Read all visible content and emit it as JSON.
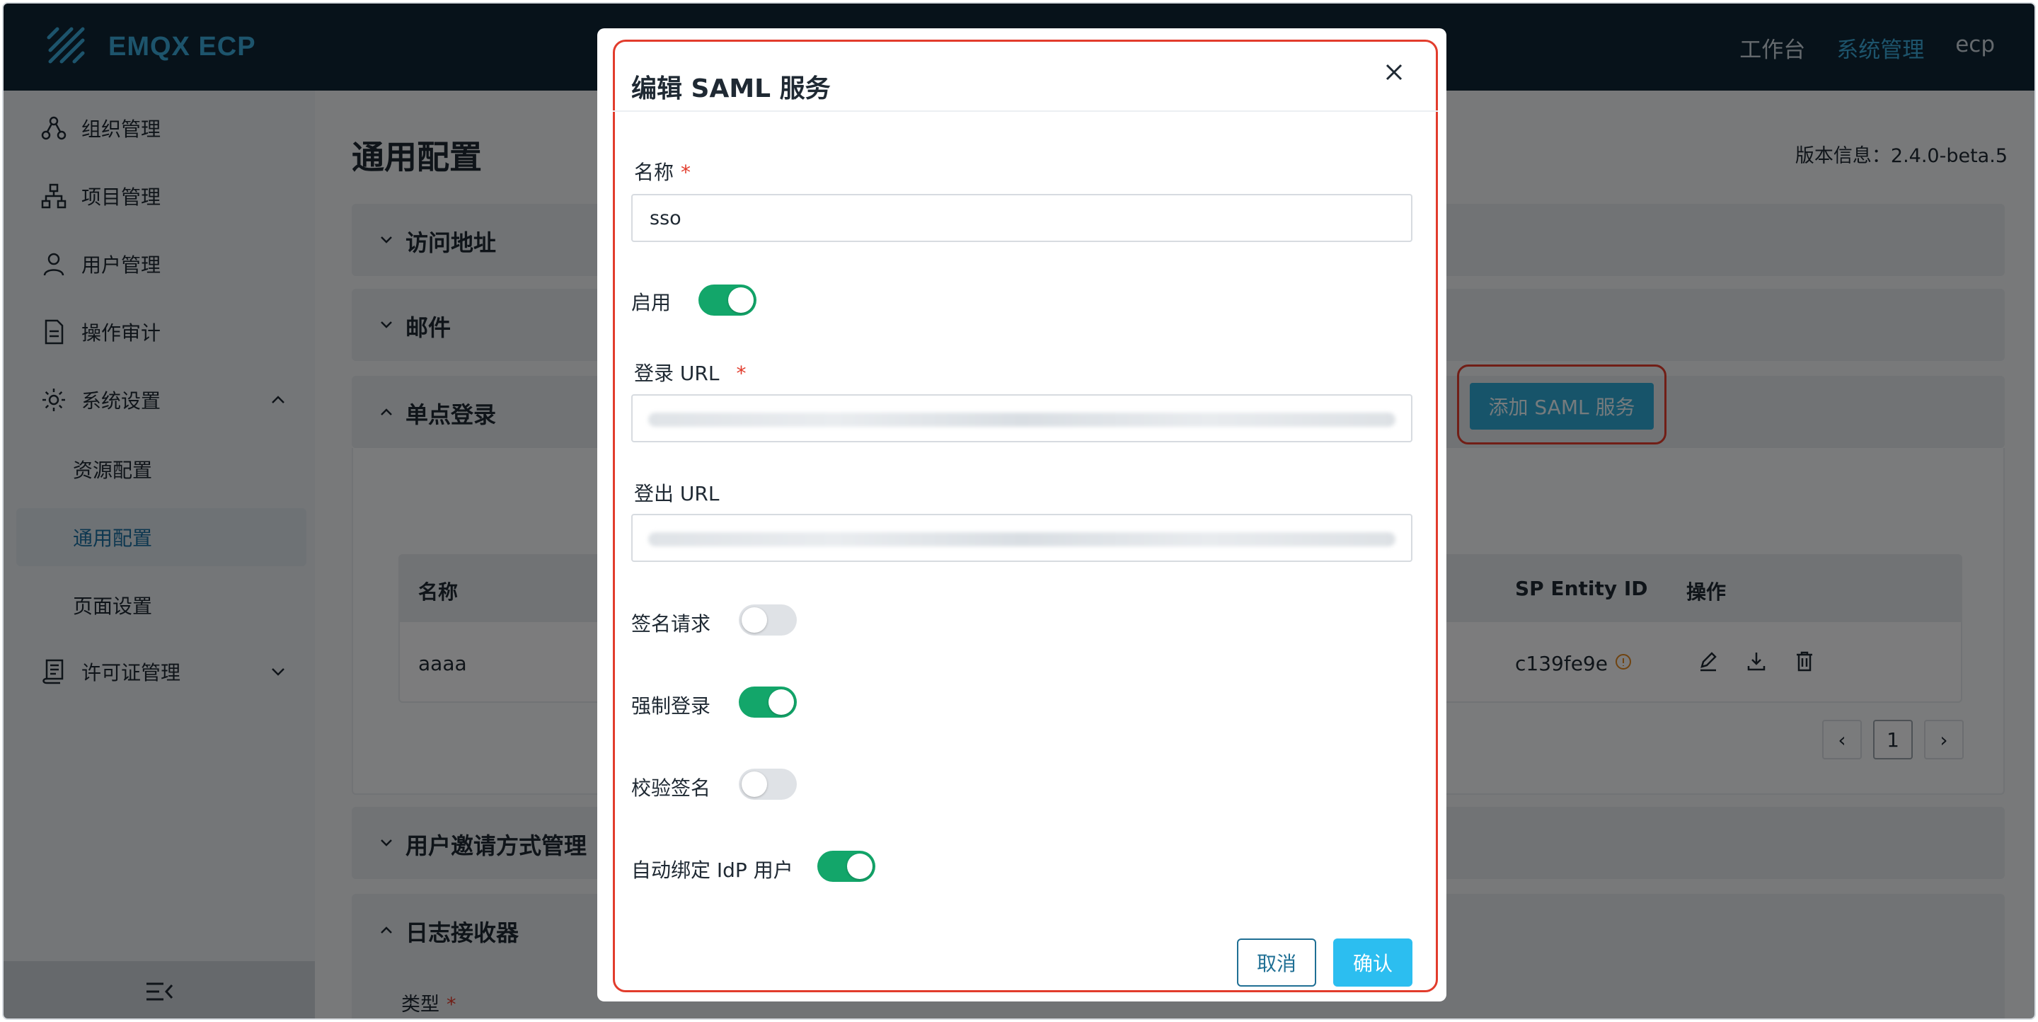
{
  "header": {
    "brand": "EMQX ECP",
    "nav": [
      "工作台",
      "系统管理",
      "ecp"
    ],
    "active_nav": "系统管理"
  },
  "sidebar": {
    "items": [
      {
        "label": "组织管理",
        "icon": "org-icon"
      },
      {
        "label": "项目管理",
        "icon": "project-icon"
      },
      {
        "label": "用户管理",
        "icon": "user-icon"
      },
      {
        "label": "操作审计",
        "icon": "audit-icon"
      },
      {
        "label": "系统设置",
        "icon": "gear-icon",
        "expanded": true
      },
      {
        "label": "许可证管理",
        "icon": "license-icon",
        "expanded": false
      }
    ],
    "sub_items": [
      "资源配置",
      "通用配置",
      "页面设置"
    ],
    "active_sub": "通用配置"
  },
  "main": {
    "title": "通用配置",
    "version": "版本信息：2.4.0-beta.5",
    "sections": [
      {
        "label": "访问地址",
        "expanded": false
      },
      {
        "label": "邮件",
        "expanded": false
      },
      {
        "label": "单点登录",
        "expanded": true
      },
      {
        "label": "用户邀请方式管理",
        "expanded": false
      },
      {
        "label": "日志接收器",
        "expanded": true
      }
    ],
    "add_button": "添加 SAML 服务",
    "table": {
      "headers": {
        "name": "名称",
        "sp_entity": "SP Entity ID",
        "actions": "操作"
      },
      "rows": [
        {
          "name": "aaaa",
          "sp_entity": "c139fe9e"
        }
      ]
    },
    "pager": {
      "prev": "‹",
      "page": "1",
      "next": "›"
    },
    "log_type_label": "类型"
  },
  "modal": {
    "title": "编辑 SAML 服务",
    "fields": {
      "name_label": "名称",
      "name_value": "sso",
      "enable_label": "启用",
      "login_url_label": "登录 URL",
      "logout_url_label": "登出 URL",
      "sign_request_label": "签名请求",
      "force_login_label": "强制登录",
      "verify_sign_label": "校验签名",
      "auto_bind_label": "自动绑定 IdP 用户"
    },
    "toggles": {
      "enable": true,
      "sign_request": false,
      "force_login": true,
      "verify_sign": false,
      "auto_bind": true
    },
    "required_mark": "*",
    "cancel": "取消",
    "confirm": "确认"
  },
  "colors": {
    "header_bg": "#0f2434",
    "accent": "#3aa9d8",
    "toggle_on": "#13a66a",
    "highlight": "#e23c2c",
    "confirm_btn": "#2cbef0"
  }
}
